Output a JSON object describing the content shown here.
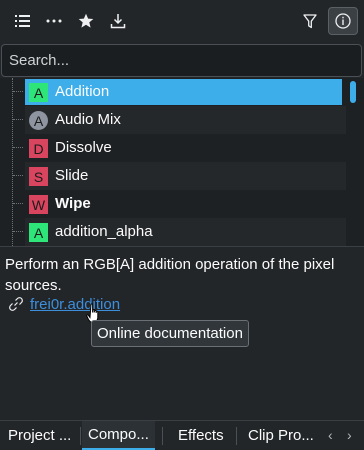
{
  "toolbar": {
    "icons": [
      "list-icon",
      "more-icon",
      "star-icon",
      "download-icon",
      "filter-icon",
      "info-icon"
    ]
  },
  "search": {
    "placeholder": "Search..."
  },
  "list": {
    "items": [
      {
        "badge": "A",
        "badge_color": "#2ee57a",
        "label": "Addition",
        "selected": true
      },
      {
        "badge": "A",
        "badge_color": "#8e94a0",
        "label": "Audio Mix",
        "selected": false
      },
      {
        "badge": "D",
        "badge_color": "#d9455f",
        "label": "Dissolve",
        "selected": false
      },
      {
        "badge": "S",
        "badge_color": "#d9455f",
        "label": "Slide",
        "selected": false
      },
      {
        "badge": "W",
        "badge_color": "#d9455f",
        "label": "Wipe",
        "selected": false,
        "bold": true
      },
      {
        "badge": "A",
        "badge_color": "#2ee57a",
        "label": "addition_alpha",
        "selected": false
      }
    ]
  },
  "description": {
    "text": "Perform an RGB[A] addition operation of the pixel sources.",
    "link": "frei0r.addition",
    "tooltip": "Online documentation"
  },
  "tabs": [
    {
      "label": "Project ...",
      "active": false
    },
    {
      "label": "Compo...",
      "active": true
    },
    {
      "label": "Effects",
      "active": false
    },
    {
      "label": "Clip Pro...",
      "active": false
    }
  ],
  "colors": {
    "accent": "#3daee9",
    "background": "#232629",
    "green_badge": "#2ee57a",
    "red_badge": "#d9455f"
  }
}
